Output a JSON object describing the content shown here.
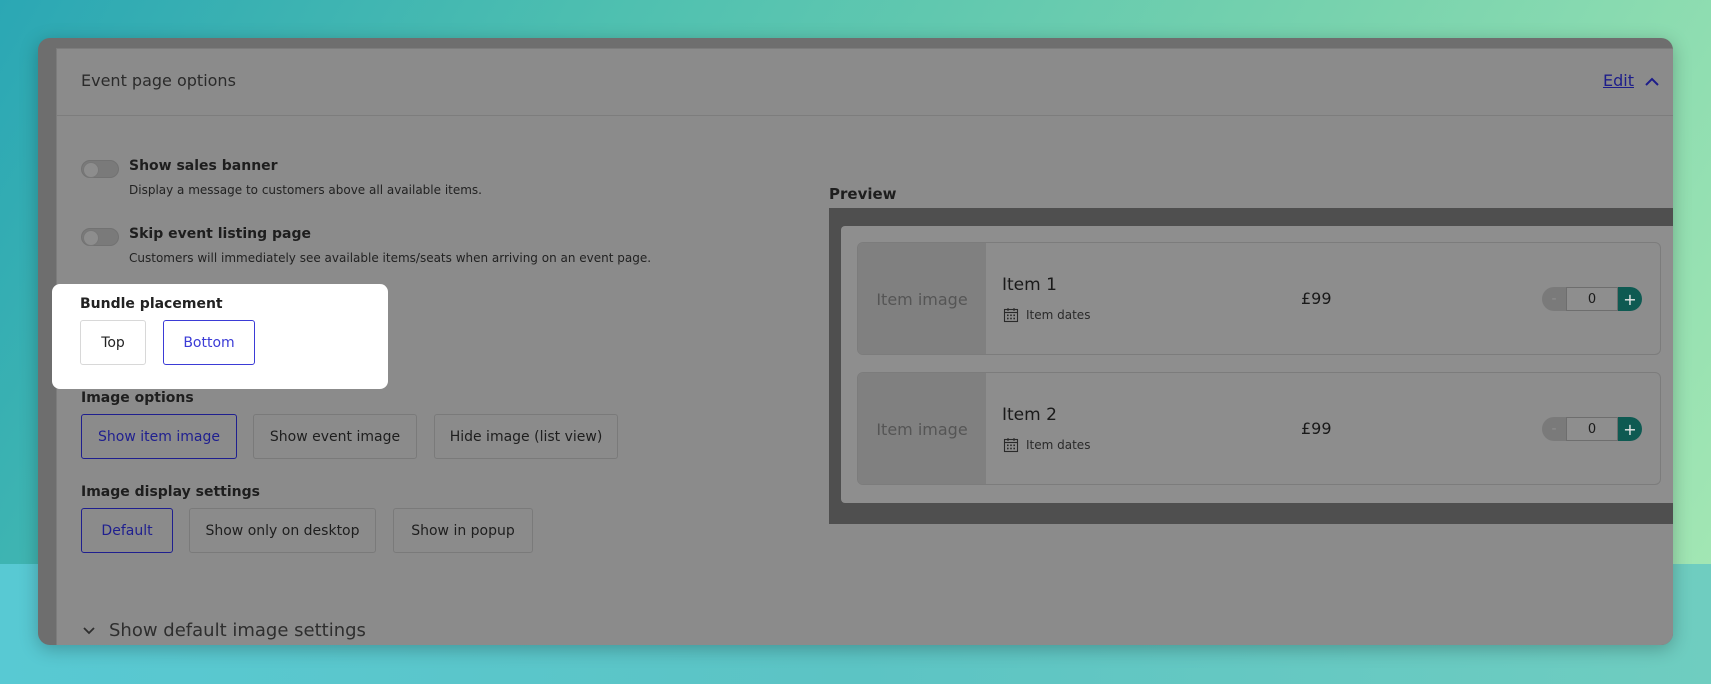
{
  "panel": {
    "title": "Event page options",
    "edit_label": "Edit"
  },
  "toggles": [
    {
      "label": "Show sales banner",
      "description": "Display a message to customers above all available items.",
      "on": false
    },
    {
      "label": "Skip event listing page",
      "description": "Customers will immediately see available items/seats when arriving on an event page.",
      "on": false
    }
  ],
  "bundle_placement": {
    "label": "Bundle placement",
    "options": [
      "Top",
      "Bottom"
    ],
    "selected": "Bottom"
  },
  "image_options": {
    "label": "Image options",
    "options": [
      "Show item image",
      "Show event image",
      "Hide image (list view)"
    ],
    "selected": "Show item image"
  },
  "image_display_settings": {
    "label": "Image display settings",
    "options": [
      "Default",
      "Show only on desktop",
      "Show in popup"
    ],
    "selected": "Default"
  },
  "expander": {
    "label": "Show default image settings"
  },
  "preview": {
    "label": "Preview",
    "items": [
      {
        "image_text": "Item image",
        "name": "Item 1",
        "dates": "Item dates",
        "price": "£99",
        "quantity": "0"
      },
      {
        "image_text": "Item image",
        "name": "Item 2",
        "dates": "Item dates",
        "price": "£99",
        "quantity": "0"
      }
    ]
  },
  "colors": {
    "accent": "#3b3bd6",
    "plus_button": "#0e5a52"
  }
}
